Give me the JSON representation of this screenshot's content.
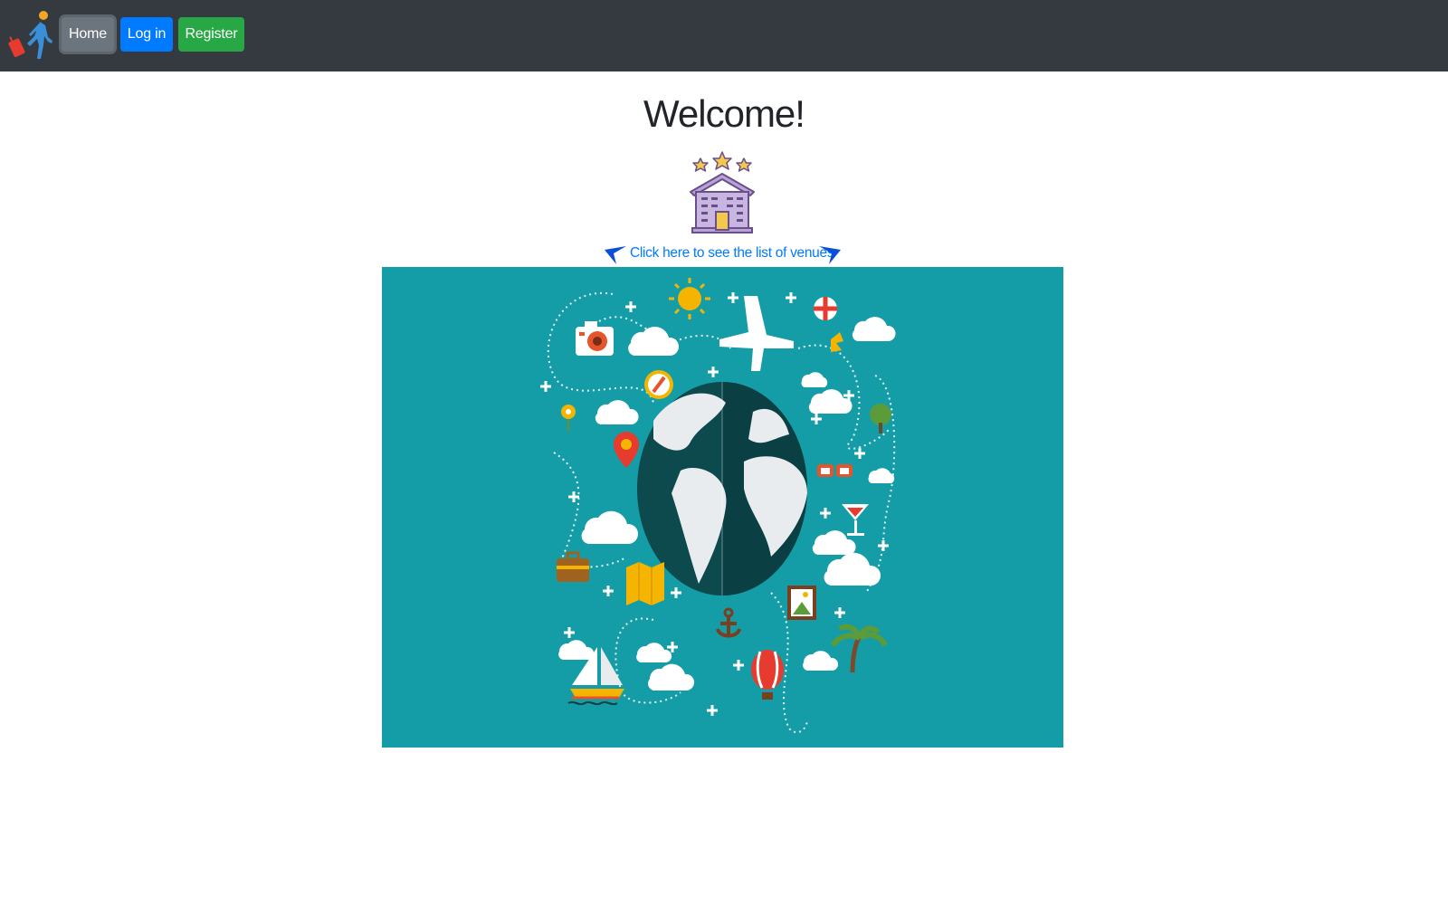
{
  "navbar": {
    "logo_icon": "traveler-with-suitcase-icon",
    "buttons": [
      {
        "label": "Home",
        "color": "#6c757d"
      },
      {
        "label": "Log in",
        "color": "#007bff"
      },
      {
        "label": "Register",
        "color": "#28a745"
      }
    ],
    "background": "#343a40"
  },
  "main": {
    "title": "Welcome!",
    "hotel_icon": "hotel-stars-icon",
    "venues_link": {
      "label": "Click here to see the list of venues",
      "left_icon": "arrow-pointer-icon",
      "right_icon": "arrow-pointer-icon",
      "color": "#007bff"
    },
    "banner": {
      "icon": "travel-world-illustration",
      "background": "#149da6"
    }
  }
}
